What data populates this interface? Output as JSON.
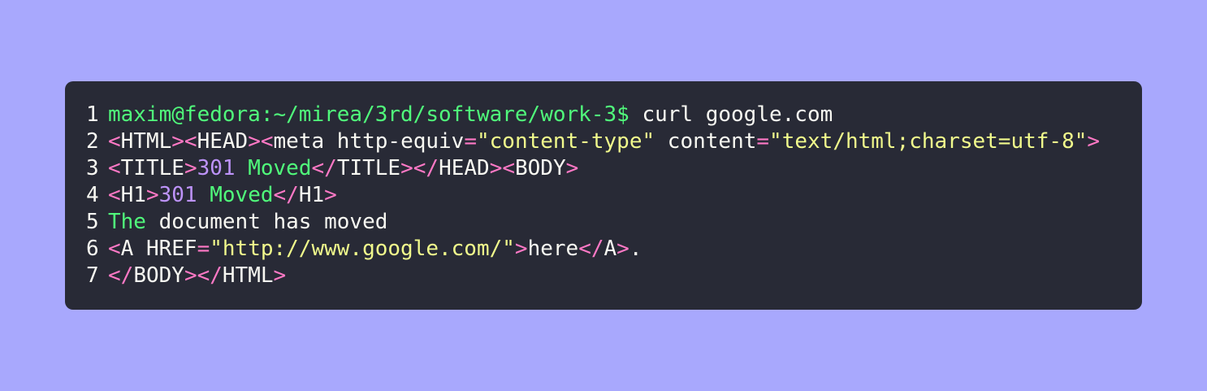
{
  "colors": {
    "page_background": "#a8a8fd",
    "editor_background": "#282a36",
    "default_text": "#f8f8f2",
    "green": "#50fa7b",
    "pink": "#ff79c6",
    "yellow": "#f1fa8c",
    "purple": "#bd93f9"
  },
  "lines": [
    {
      "number": "1",
      "tokens": [
        {
          "text": "maxim@fedora:~/mirea/3rd/software/work-3$",
          "color": "green"
        },
        {
          "text": " curl google.com",
          "color": "default"
        }
      ]
    },
    {
      "number": "2",
      "tokens": [
        {
          "text": "<",
          "color": "pink"
        },
        {
          "text": "HTML",
          "color": "default"
        },
        {
          "text": "><",
          "color": "pink"
        },
        {
          "text": "HEAD",
          "color": "default"
        },
        {
          "text": "><",
          "color": "pink"
        },
        {
          "text": "meta http-equiv",
          "color": "default"
        },
        {
          "text": "=",
          "color": "pink"
        },
        {
          "text": "\"content-type\"",
          "color": "yellow"
        },
        {
          "text": " content",
          "color": "default"
        },
        {
          "text": "=",
          "color": "pink"
        },
        {
          "text": "\"text/html;charset=utf-8\"",
          "color": "yellow"
        },
        {
          "text": ">",
          "color": "pink"
        }
      ]
    },
    {
      "number": "3",
      "tokens": [
        {
          "text": "<",
          "color": "pink"
        },
        {
          "text": "TITLE",
          "color": "default"
        },
        {
          "text": ">",
          "color": "pink"
        },
        {
          "text": "301",
          "color": "purple"
        },
        {
          "text": " ",
          "color": "default"
        },
        {
          "text": "Moved",
          "color": "green"
        },
        {
          "text": "</",
          "color": "pink"
        },
        {
          "text": "TITLE",
          "color": "default"
        },
        {
          "text": "></",
          "color": "pink"
        },
        {
          "text": "HEAD",
          "color": "default"
        },
        {
          "text": "><",
          "color": "pink"
        },
        {
          "text": "BODY",
          "color": "default"
        },
        {
          "text": ">",
          "color": "pink"
        }
      ]
    },
    {
      "number": "4",
      "tokens": [
        {
          "text": "<",
          "color": "pink"
        },
        {
          "text": "H1",
          "color": "default"
        },
        {
          "text": ">",
          "color": "pink"
        },
        {
          "text": "301",
          "color": "purple"
        },
        {
          "text": " ",
          "color": "default"
        },
        {
          "text": "Moved",
          "color": "green"
        },
        {
          "text": "</",
          "color": "pink"
        },
        {
          "text": "H1",
          "color": "default"
        },
        {
          "text": ">",
          "color": "pink"
        }
      ]
    },
    {
      "number": "5",
      "tokens": [
        {
          "text": "The",
          "color": "green"
        },
        {
          "text": " document has moved",
          "color": "default"
        }
      ]
    },
    {
      "number": "6",
      "tokens": [
        {
          "text": "<",
          "color": "pink"
        },
        {
          "text": "A HREF",
          "color": "default"
        },
        {
          "text": "=",
          "color": "pink"
        },
        {
          "text": "\"http://www.google.com/\"",
          "color": "yellow"
        },
        {
          "text": ">",
          "color": "pink"
        },
        {
          "text": "here",
          "color": "default"
        },
        {
          "text": "</",
          "color": "pink"
        },
        {
          "text": "A",
          "color": "default"
        },
        {
          "text": ">",
          "color": "pink"
        },
        {
          "text": ".",
          "color": "default"
        }
      ]
    },
    {
      "number": "7",
      "tokens": [
        {
          "text": "</",
          "color": "pink"
        },
        {
          "text": "BODY",
          "color": "default"
        },
        {
          "text": "></",
          "color": "pink"
        },
        {
          "text": "HTML",
          "color": "default"
        },
        {
          "text": ">",
          "color": "pink"
        }
      ]
    }
  ]
}
